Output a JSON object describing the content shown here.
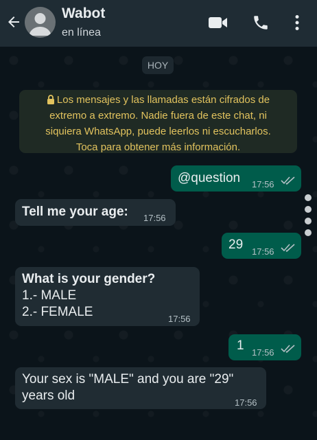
{
  "header": {
    "name": "Wabot",
    "status": "en línea"
  },
  "chat": {
    "date_chip": "HOY",
    "encryption_notice": "Los mensajes y las llamadas están cifrados de extremo a extremo. Nadie fuera de este chat, ni siquiera WhatsApp, puede leerlos ni escucharlos. Toca para obtener más información.",
    "notice_lines": [
      "Los mensajes y las llamadas están cifrados de",
      "extremo a extremo. Nadie fuera de este chat, ni",
      "siquiera WhatsApp, puede leerlos ni escucharlos.",
      "Toca para obtener más información."
    ],
    "messages": [
      {
        "direction": "out",
        "text": "@question",
        "time": "17:56"
      },
      {
        "direction": "in",
        "text": "Tell me your age:",
        "time": "17:56"
      },
      {
        "direction": "out",
        "text": "29",
        "time": "17:56"
      },
      {
        "direction": "in",
        "lines": [
          "What is your gender?",
          "1.- MALE",
          "2.- FEMALE"
        ],
        "time": "17:56"
      },
      {
        "direction": "out",
        "text": "1",
        "time": "17:56"
      },
      {
        "direction": "in",
        "lines": [
          "Your sex is \"MALE\" and you are \"29\"",
          "years old"
        ],
        "time": "17:56"
      }
    ]
  },
  "colors": {
    "header_bg": "#1f2c34",
    "chat_bg": "#0b141a",
    "outgoing_bubble": "#005c4b",
    "incoming_bubble": "#202c33",
    "notice_text": "#e2c35e"
  },
  "icons": [
    "back-arrow-icon",
    "avatar-icon",
    "video-call-icon",
    "phone-icon",
    "more-options-icon",
    "lock-icon",
    "double-check-icon"
  ]
}
